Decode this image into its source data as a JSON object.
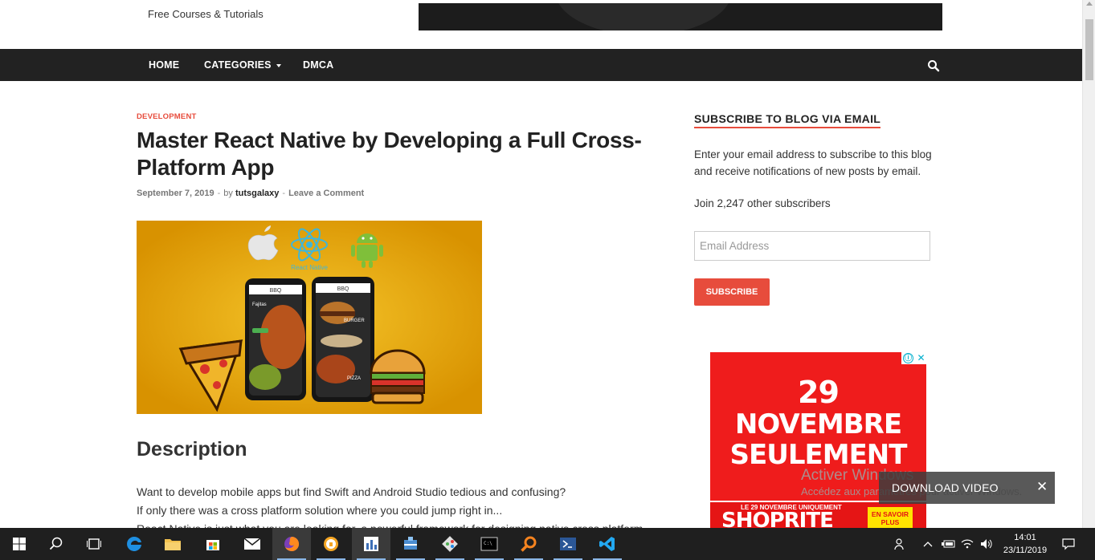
{
  "header": {
    "tagline": "Free Courses & Tutorials"
  },
  "nav": {
    "items": [
      "HOME",
      "CATEGORIES",
      "DMCA"
    ]
  },
  "article": {
    "category": "DEVELOPMENT",
    "title": "Master React Native by Developing a Full Cross-Platform App",
    "date": "September 7, 2019",
    "by": "by",
    "author": "tutsgalaxy",
    "comment_link": "Leave a Comment",
    "image_texts": {
      "react_label": "React Native",
      "app_title_left": "BBQ",
      "app_title_right": "BBQ",
      "left_screen_title": "Fajitas",
      "right_label_top": "BURGER",
      "right_label_bottom": "PIZZA"
    },
    "description_heading": "Description",
    "body_lines": [
      "Want to develop mobile apps but find Swift and Android Studio tedious and confusing?",
      "If only there was a cross platform solution where you could jump right in...",
      "React Native is just what you are looking for, a powerful framework for designing native cross platform"
    ]
  },
  "sidebar": {
    "widget_title": "SUBSCRIBE TO BLOG VIA EMAIL",
    "widget_text": "Enter your email address to subscribe to this blog and receive notifications of new posts by email.",
    "subscribers": "Join 2,247 other subscribers",
    "email_placeholder": "Email Address",
    "subscribe_label": "SUBSCRIBE"
  },
  "ad": {
    "line1": "29",
    "line2": "NOVEMBRE",
    "line3": "SEULEMENT",
    "strip_small": "LE 29 NOVEMBRE UNIQUEMENT",
    "brand": "SHOPRITE",
    "badge": "EN SAVOIR PLUS",
    "info_icon": "ⓘ",
    "close_icon": "✕"
  },
  "overlays": {
    "activate_title": "Activer Windows",
    "activate_sub": "Accédez aux paramètres pour activer Windows.",
    "download_label": "DOWNLOAD VIDEO",
    "download_close": "✕"
  },
  "taskbar": {
    "time": "14:01",
    "date": "23/11/2019",
    "icons": [
      "start-icon",
      "search-icon",
      "task-view-icon",
      "edge-icon",
      "file-explorer-icon",
      "store-icon",
      "mail-icon",
      "firefox-icon",
      "vpn-icon",
      "office-app-icon",
      "network-app-icon",
      "git-icon",
      "terminal-icon",
      "magnifier-app-icon",
      "powershell-icon",
      "vscode-icon"
    ]
  },
  "colors": {
    "accent": "#e74c3c",
    "nav_bg": "#222222",
    "image_bg": "#e5a500",
    "ad_red": "#ef1c1c"
  }
}
